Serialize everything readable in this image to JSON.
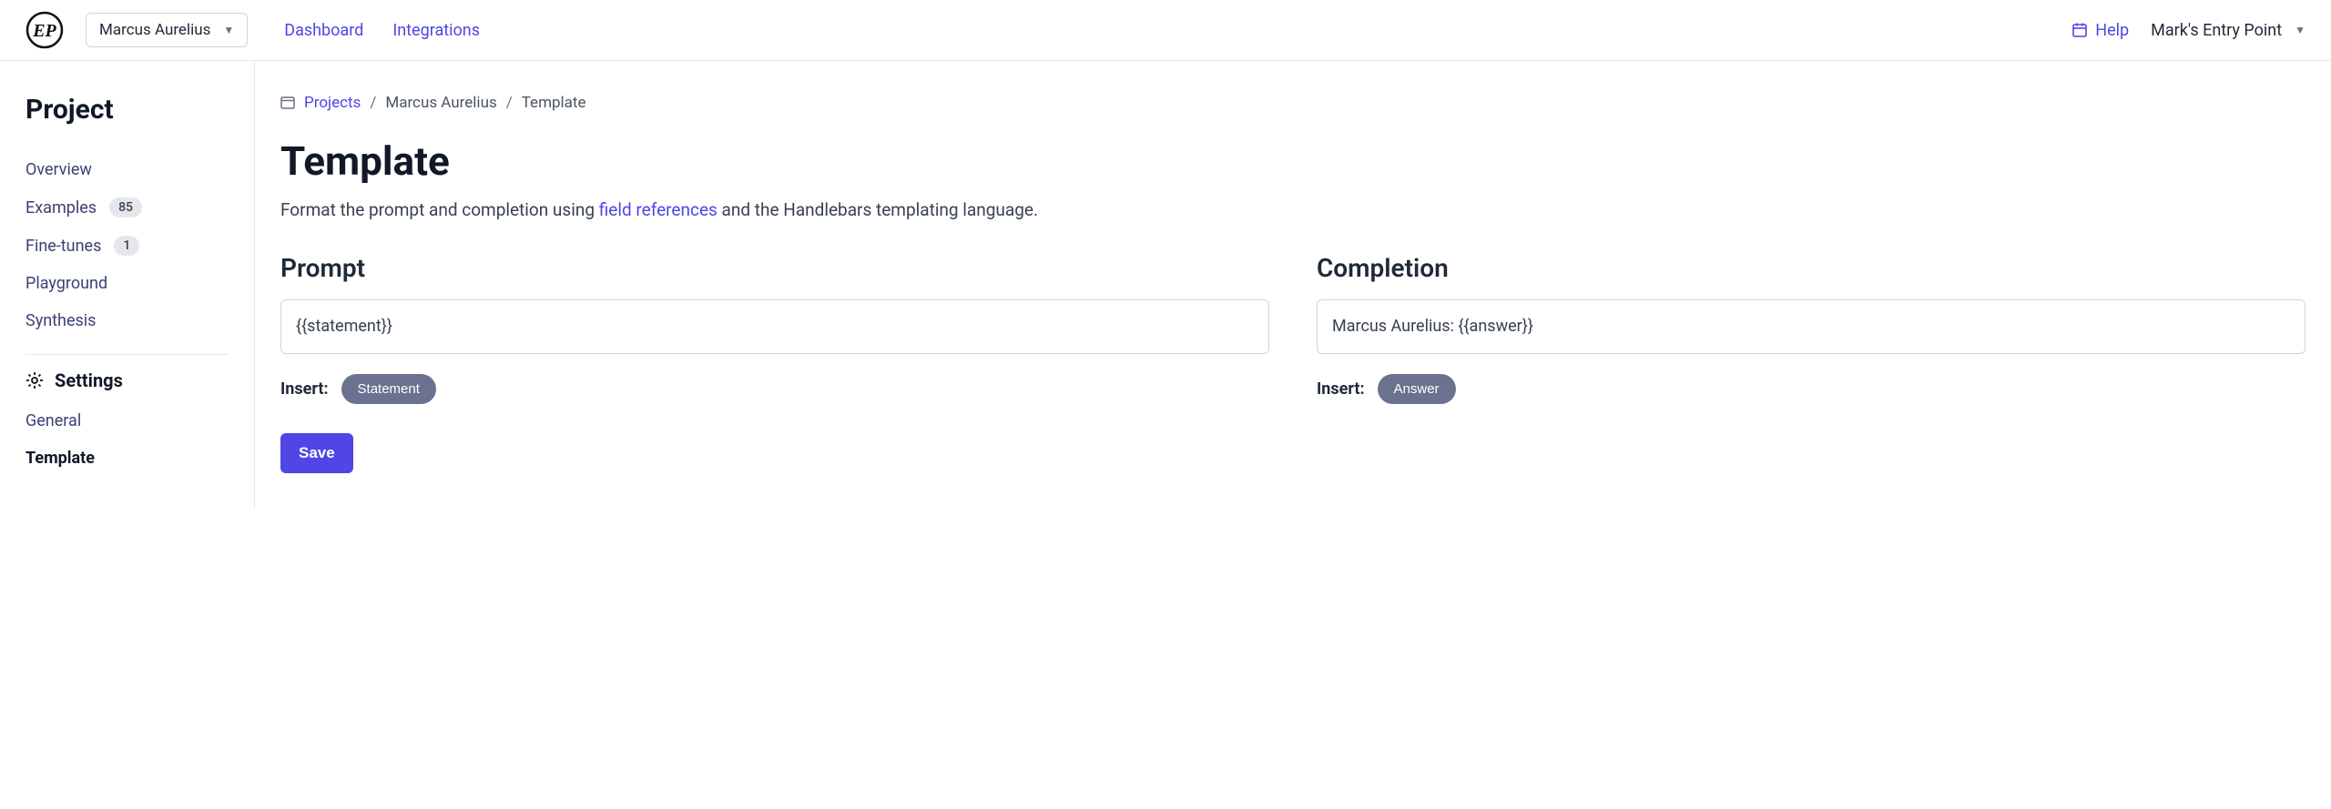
{
  "header": {
    "project_name": "Marcus Aurelius",
    "nav": {
      "dashboard": "Dashboard",
      "integrations": "Integrations"
    },
    "help_label": "Help",
    "user_name": "Mark's Entry Point"
  },
  "sidebar": {
    "title": "Project",
    "items": {
      "overview": "Overview",
      "examples": {
        "label": "Examples",
        "count": "85"
      },
      "finetunes": {
        "label": "Fine-tunes",
        "count": "1"
      },
      "playground": "Playground",
      "synthesis": "Synthesis"
    },
    "settings": {
      "header": "Settings",
      "general": "General",
      "template": "Template"
    }
  },
  "breadcrumb": {
    "projects": "Projects",
    "project": "Marcus Aurelius",
    "current": "Template",
    "sep": "/"
  },
  "page": {
    "title": "Template",
    "description_pre": "Format the prompt and completion using ",
    "description_link": "field references",
    "description_post": " and the Handlebars templating language."
  },
  "prompt": {
    "heading": "Prompt",
    "value": "{{statement}}",
    "insert_label": "Insert:",
    "chip": "Statement"
  },
  "completion": {
    "heading": "Completion",
    "value": "Marcus Aurelius: {{answer}}",
    "insert_label": "Insert:",
    "chip": "Answer"
  },
  "buttons": {
    "save": "Save"
  }
}
